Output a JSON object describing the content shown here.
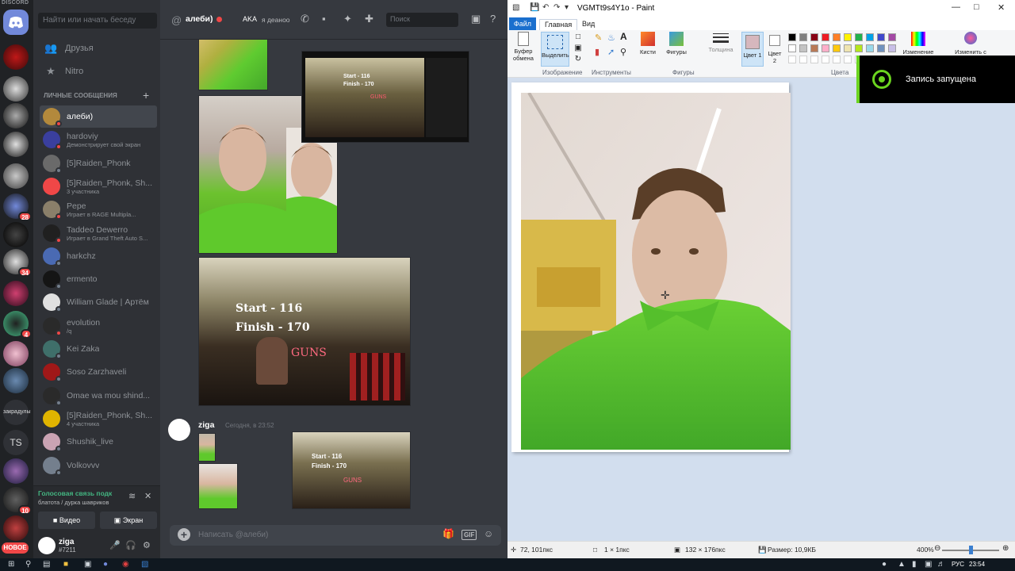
{
  "discord": {
    "brand": "DISCORD",
    "new_badge": "НОВОЕ",
    "guild_badges": [
      "28",
      "34",
      "4",
      "10"
    ],
    "guild_labels": [
      "TS",
      "закрадулы"
    ],
    "search_placeholder": "Найти или начать беседу",
    "nav": {
      "friends": "Друзья",
      "nitro": "Nitro"
    },
    "dm_header": "ЛИЧНЫЕ СООБЩЕНИЯ",
    "dms": [
      {
        "name": "алеби)",
        "sub": "",
        "color": "#b3893c",
        "status": "#f04747"
      },
      {
        "name": "hardoviy",
        "sub": "Демонстрирует свой экран",
        "color": "#3a3f9e",
        "status": "#f04747"
      },
      {
        "name": "[5]Raiden_Phonk",
        "sub": "",
        "color": "#6a6a6a",
        "status": "#747f8d"
      },
      {
        "name": "[5]Raiden_Phonk, Sh...",
        "sub": "3 участника",
        "color": "#f04747",
        "status": ""
      },
      {
        "name": "Pepe",
        "sub": "Играет в RAGE Multipla...",
        "color": "#8a7f6a",
        "status": "#f04747"
      },
      {
        "name": "Taddeo Dewerro",
        "sub": "Играет в Grand Theft Auto S...",
        "color": "#202020",
        "status": "#f04747"
      },
      {
        "name": "harkchz",
        "sub": "",
        "color": "#4a6ab3",
        "status": "#747f8d"
      },
      {
        "name": "ermento",
        "sub": "",
        "color": "#151515",
        "status": "#747f8d"
      },
      {
        "name": "William Glade | Артём",
        "sub": "",
        "color": "#e0e0e0",
        "status": "#747f8d"
      },
      {
        "name": "evolution",
        "sub": "/q",
        "color": "#2a2a2a",
        "status": "#f04747"
      },
      {
        "name": "Kei Zaka",
        "sub": "",
        "color": "#3f6f6a",
        "status": "#747f8d"
      },
      {
        "name": "Soso Zarzhaveli",
        "sub": "",
        "color": "#a01818",
        "status": "#747f8d"
      },
      {
        "name": "Omae wa mou shind...",
        "sub": "",
        "color": "#2a2a2a",
        "status": "#747f8d"
      },
      {
        "name": "[5]Raiden_Phonk, Sh...",
        "sub": "4 участника",
        "color": "#e0b400",
        "status": ""
      },
      {
        "name": "Shushik_live",
        "sub": "",
        "color": "#caa3b3",
        "status": "#747f8d"
      },
      {
        "name": "Volkovvv",
        "sub": "",
        "color": "#747f8d",
        "status": "#747f8d"
      }
    ],
    "voice": {
      "title": "Голосовая связь подк",
      "sub": "блатота / дурка шавриков",
      "video": "Видео",
      "screen": "Экран"
    },
    "user": {
      "name": "ziga",
      "tag": "#7211"
    },
    "chat": {
      "name": "алеби)",
      "aka": "AKA",
      "aka_text": "я деаноо",
      "search_placeholder": "Поиск",
      "message_user": "ziga",
      "message_time": "Сегодня, в 23:52",
      "composer_placeholder": "Написать @алеби)",
      "gif": "GIF",
      "video_text": {
        "start": "Start - 116",
        "finish": "Finish - 170",
        "sign": "GUNS"
      }
    }
  },
  "paint": {
    "title": "VGMTt9s4Y1o - Paint",
    "tabs": {
      "file": "Файл",
      "home": "Главная",
      "view": "Вид"
    },
    "ribbon": {
      "clipboard": "Буфер обмена",
      "select": "Выделить",
      "group_image": "Изображение",
      "group_tools": "Инструменты",
      "brushes": "Кисти",
      "shapes": "Фигуры",
      "group_shapes": "Фигуры",
      "thickness": "Толщина",
      "color1": "Цвет 1",
      "color2": "Цвет 2",
      "group_colors": "Цвета",
      "edit_colors": "Изменение",
      "edit3d": "Изменить с"
    },
    "palette": [
      "#000000",
      "#7f7f7f",
      "#880015",
      "#ed1c24",
      "#ff7f27",
      "#fff200",
      "#22b14c",
      "#00a2e8",
      "#3f48cc",
      "#a349a4",
      "#ffffff",
      "#c3c3c3",
      "#b97a57",
      "#ffaec9",
      "#ffc90e",
      "#efe4b0",
      "#b5e61d",
      "#99d9ea",
      "#7092be",
      "#c8bfe7"
    ],
    "color1": "#d6b7bd",
    "color2": "#ffffff",
    "status": {
      "pos": "72, 101пкс",
      "sel": "1 × 1пкс",
      "size": "132 × 176пкс",
      "file": "Размер: 10,9КБ",
      "zoom": "400%"
    },
    "zoom_fraction": 0.5,
    "toast": "Запись запущена"
  },
  "taskbar": {
    "lang": "РУС",
    "time": "23:54"
  }
}
